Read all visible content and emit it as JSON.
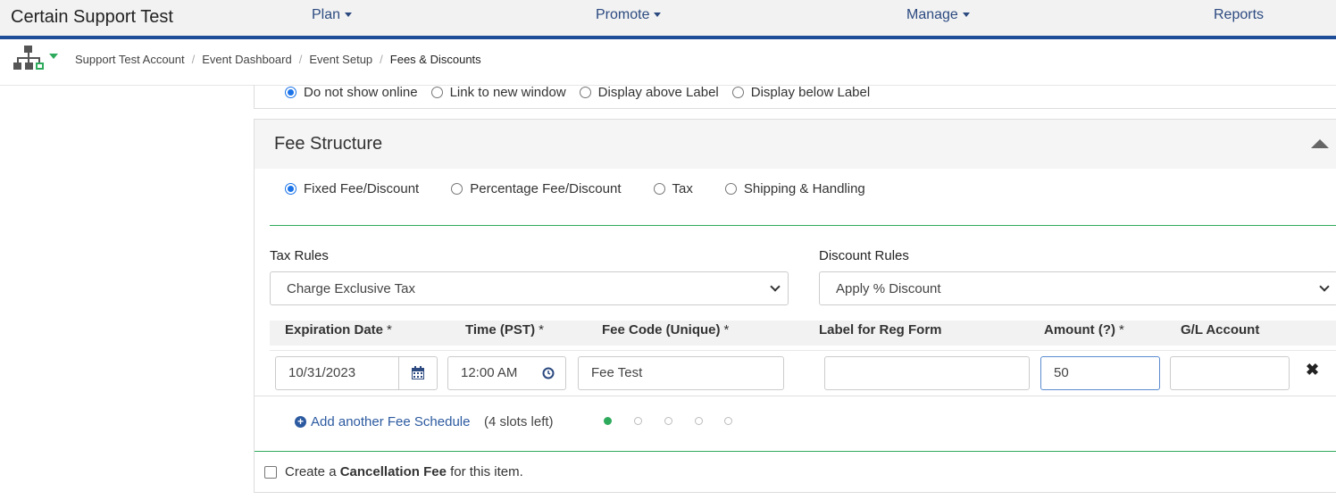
{
  "app": {
    "title": "Certain Support Test"
  },
  "nav": {
    "plan": "Plan",
    "promote": "Promote",
    "manage": "Manage",
    "reports": "Reports"
  },
  "breadcrumb": {
    "items": [
      "Support Test Account",
      "Event Dashboard",
      "Event Setup",
      "Fees & Discounts"
    ],
    "separator": "/"
  },
  "display_options": {
    "options": [
      "Do not show online",
      "Link to new window",
      "Display above Label",
      "Display below Label"
    ],
    "selected": "Do not show online"
  },
  "fee_structure": {
    "title": "Fee Structure",
    "types": [
      "Fixed Fee/Discount",
      "Percentage Fee/Discount",
      "Tax",
      "Shipping & Handling"
    ],
    "selected_type": "Fixed Fee/Discount",
    "tax_rules": {
      "label": "Tax Rules",
      "value": "Charge Exclusive Tax"
    },
    "discount_rules": {
      "label": "Discount Rules",
      "value": "Apply % Discount"
    },
    "columns": {
      "expiration_date": "Expiration Date",
      "time": "Time (PST)",
      "fee_code": "Fee Code (Unique)",
      "label": "Label for Reg Form",
      "amount": "Amount (?)",
      "gl_account": "G/L Account",
      "required_mark": "*"
    },
    "row": {
      "expiration_date": "10/31/2023",
      "time": "12:00 AM",
      "fee_code": "Fee Test",
      "label": "",
      "amount": "50",
      "gl_account": ""
    },
    "add_schedule": "Add another Fee Schedule",
    "slots_left": "(4 slots left)",
    "slots_total": 5,
    "slots_used": 1
  },
  "cancellation": {
    "prefix": "Create a",
    "bold": "Cancellation Fee",
    "suffix": "for this item."
  },
  "colors": {
    "nav_bar": "#1f4e99",
    "accent_green": "#2eaa5c",
    "link_blue": "#2c5aa0"
  }
}
